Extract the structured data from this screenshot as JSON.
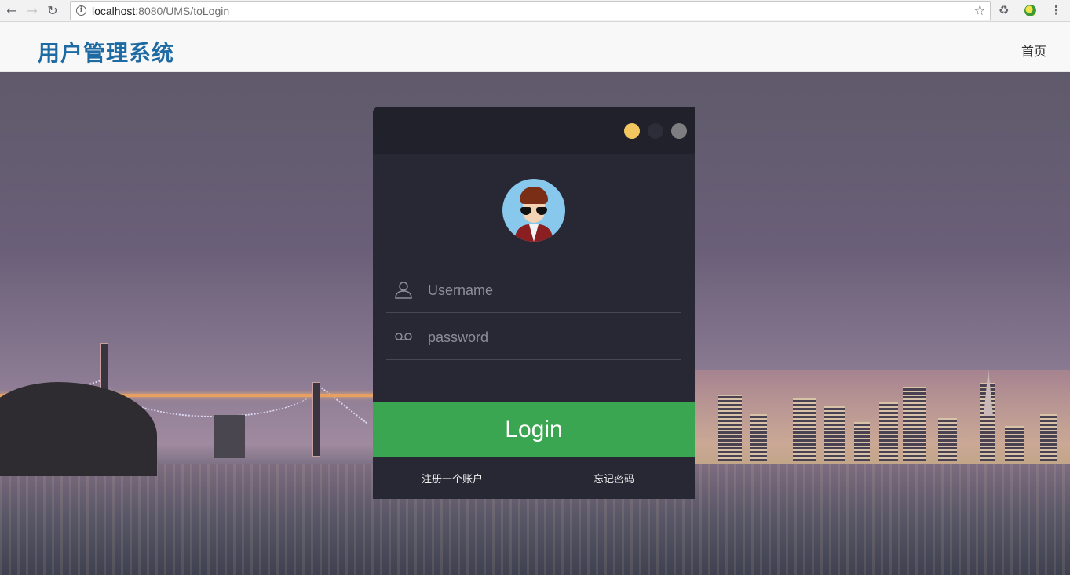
{
  "browser": {
    "url_host": "localhost",
    "url_path": ":8080/UMS/toLogin",
    "back_icon": "←",
    "forward_icon": "→",
    "reload_icon": "↻",
    "star_icon": "☆",
    "extension_icon": "♻",
    "menu_icon": "⋮"
  },
  "header": {
    "brand": "用户管理系统",
    "nav_home": "首页",
    "brand_color": "#1e6aa3"
  },
  "login": {
    "username_placeholder": "Username",
    "password_placeholder": "password",
    "login_label": "Login",
    "register_link": "注册一个账户",
    "forgot_link": "忘记密码",
    "accent_color": "#3aa651",
    "window_dots": [
      "#f2c760",
      "#2c2d38",
      "#7e7e80"
    ]
  }
}
